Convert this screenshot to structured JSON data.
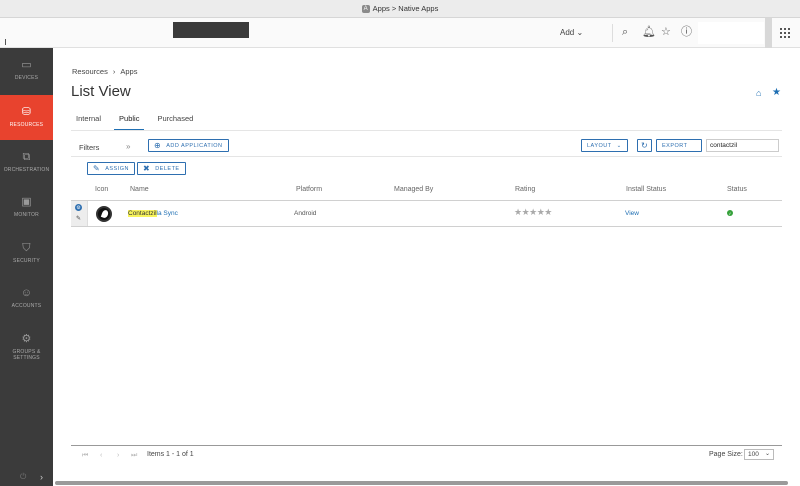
{
  "window": {
    "title": "Apps > Native Apps"
  },
  "topbar": {
    "add_label": "Add"
  },
  "sidebar": {
    "items": [
      {
        "label": "DEVICES",
        "icon": "devices-icon"
      },
      {
        "label": "RESOURCES",
        "icon": "resources-icon",
        "active": true
      },
      {
        "label": "ORCHESTRATION",
        "icon": "orchestration-icon"
      },
      {
        "label": "MONITOR",
        "icon": "monitor-icon"
      },
      {
        "label": "SECURITY",
        "icon": "shield-icon"
      },
      {
        "label": "ACCOUNTS",
        "icon": "accounts-icon"
      },
      {
        "label": "GROUPS &\nSETTINGS",
        "icon": "gear-icon"
      }
    ]
  },
  "breadcrumb": {
    "root": "Resources",
    "current": "Apps"
  },
  "page": {
    "title": "List View"
  },
  "tabs": [
    {
      "label": "Internal"
    },
    {
      "label": "Public",
      "active": true
    },
    {
      "label": "Purchased"
    }
  ],
  "toolbar": {
    "filters_label": "Filters",
    "add_application": "ADD APPLICATION",
    "layout": "LAYOUT",
    "export": "EXPORT",
    "search_value": "contactzil",
    "assign": "ASSIGN",
    "delete": "DELETE"
  },
  "table": {
    "columns": [
      "Icon",
      "Name",
      "Platform",
      "Managed By",
      "Rating",
      "Install Status",
      "Status"
    ],
    "rows": [
      {
        "name_highlight": "Contactzil",
        "name_rest": "la Sync",
        "platform": "Android",
        "managed_by": "",
        "rating": 0,
        "install_status": "View",
        "status": "active"
      }
    ]
  },
  "pager": {
    "items_text": "Items 1 - 1 of 1",
    "page_size_label": "Page Size:",
    "page_size_value": "100"
  },
  "colors": {
    "accent": "#1f6fb3",
    "active_nav": "#e8432e",
    "sidebar_bg": "#3b3b3b",
    "highlight": "#f7f35b"
  }
}
